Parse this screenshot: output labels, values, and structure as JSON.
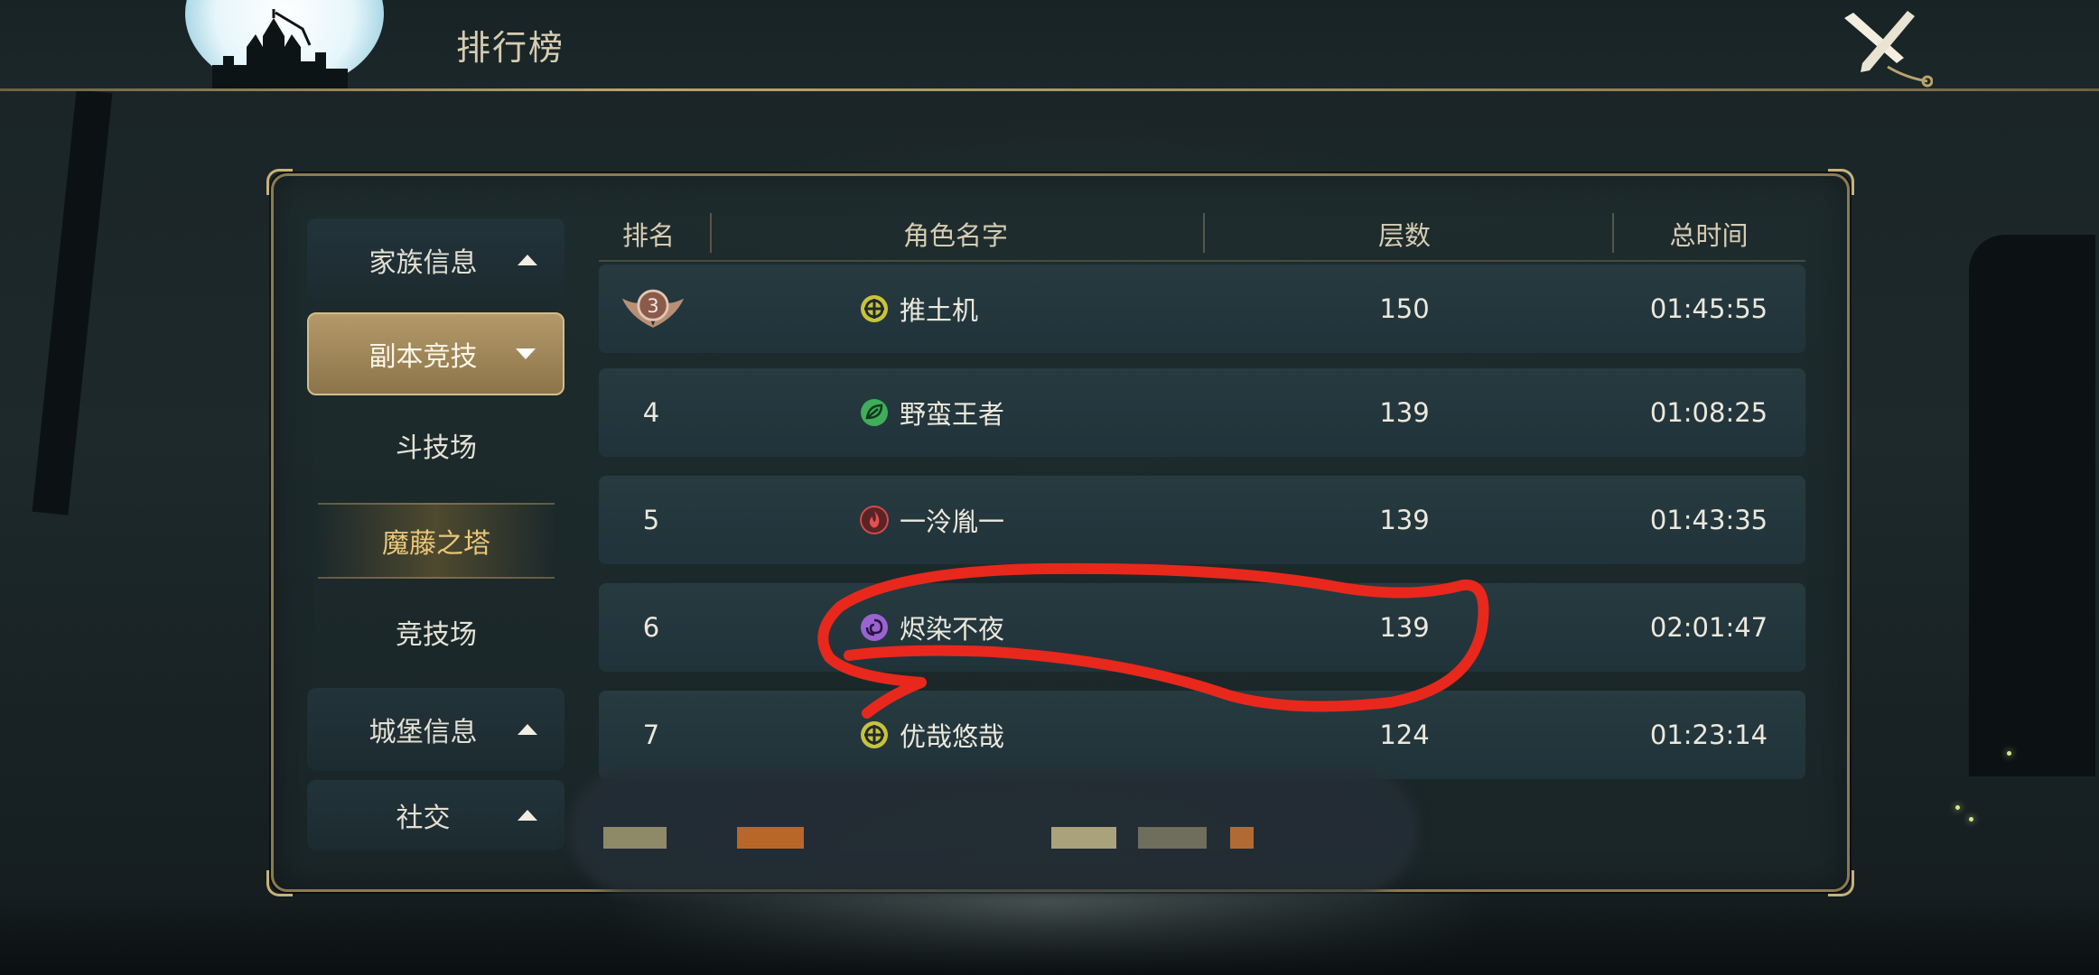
{
  "header": {
    "title": "排行榜"
  },
  "sidebar": {
    "groups": [
      {
        "label": "家族信息",
        "expanded": false
      },
      {
        "label": "副本竞技",
        "expanded": true,
        "sub_items": [
          {
            "label": "斗技场",
            "selected": false
          },
          {
            "label": "魔藤之塔",
            "selected": true
          },
          {
            "label": "竞技场",
            "selected": false
          }
        ]
      },
      {
        "label": "城堡信息",
        "expanded": false
      },
      {
        "label": "社交",
        "expanded": false
      }
    ]
  },
  "table": {
    "columns": [
      "排名",
      "角色名字",
      "层数",
      "总时间"
    ],
    "rows": [
      {
        "rank": "3",
        "rank_badge": "bronze-medal-icon",
        "class_icon": "shield-cross-icon",
        "class_color": "#c9c23a",
        "name": "推土机",
        "floors": "150",
        "time": "01:45:55"
      },
      {
        "rank": "4",
        "class_icon": "leaf-icon",
        "class_color": "#3fae5a",
        "name": "野蛮王者",
        "floors": "139",
        "time": "01:08:25"
      },
      {
        "rank": "5",
        "class_icon": "flame-icon",
        "class_color": "#d84a4a",
        "name": "一泠胤一",
        "floors": "139",
        "time": "01:43:35"
      },
      {
        "rank": "6",
        "class_icon": "vortex-icon",
        "class_color": "#9a63d1",
        "name": "烬染不夜",
        "floors": "139",
        "time": "02:01:47"
      },
      {
        "rank": "7",
        "class_icon": "shield-cross-icon",
        "class_color": "#c9c23a",
        "name": "优哉悠哉",
        "floors": "124",
        "time": "01:23:14"
      }
    ]
  },
  "colors": {
    "accent_gold": "#b49a6a",
    "annotation_red": "#e8281c"
  }
}
